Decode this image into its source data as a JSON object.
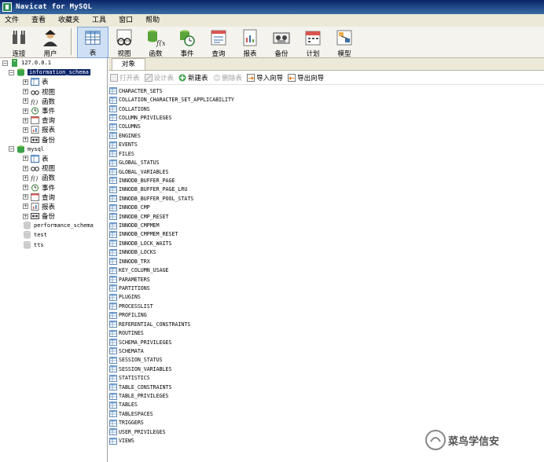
{
  "window": {
    "title": "Navicat for MySQL"
  },
  "menu": [
    "文件",
    "查看",
    "收藏夹",
    "工具",
    "窗口",
    "帮助"
  ],
  "toolbar": {
    "connect": "连接",
    "user": "用户",
    "table": "表",
    "view": "视图",
    "function": "函数",
    "event": "事件",
    "query": "查询",
    "report": "报表",
    "backup": "备份",
    "schedule": "计划",
    "model": "模型"
  },
  "tree": {
    "connection": "127.0.0.1",
    "db1": {
      "name": "information_schema",
      "children": [
        "表",
        "视图",
        "函数",
        "事件",
        "查询",
        "报表",
        "备份"
      ]
    },
    "db2": {
      "name": "mysql",
      "children": [
        "表",
        "视图",
        "函数",
        "事件",
        "查询",
        "报表",
        "备份"
      ]
    },
    "other_dbs": [
      "performance_schema",
      "test",
      "tts"
    ]
  },
  "main": {
    "tab": "对象",
    "actions": {
      "open": "打开表",
      "design": "设计表",
      "new": "新建表",
      "delete": "删除表",
      "import": "导入向导",
      "export": "导出向导"
    },
    "tables": [
      "CHARACTER_SETS",
      "COLLATION_CHARACTER_SET_APPLICABILITY",
      "COLLATIONS",
      "COLUMN_PRIVILEGES",
      "COLUMNS",
      "ENGINES",
      "EVENTS",
      "FILES",
      "GLOBAL_STATUS",
      "GLOBAL_VARIABLES",
      "INNODB_BUFFER_PAGE",
      "INNODB_BUFFER_PAGE_LRU",
      "INNODB_BUFFER_POOL_STATS",
      "INNODB_CMP",
      "INNODB_CMP_RESET",
      "INNODB_CMPMEM",
      "INNODB_CMPMEM_RESET",
      "INNODB_LOCK_WAITS",
      "INNODB_LOCKS",
      "INNODB_TRX",
      "KEY_COLUMN_USAGE",
      "PARAMETERS",
      "PARTITIONS",
      "PLUGINS",
      "PROCESSLIST",
      "PROFILING",
      "REFERENTIAL_CONSTRAINTS",
      "ROUTINES",
      "SCHEMA_PRIVILEGES",
      "SCHEMATA",
      "SESSION_STATUS",
      "SESSION_VARIABLES",
      "STATISTICS",
      "TABLE_CONSTRAINTS",
      "TABLE_PRIVILEGES",
      "TABLES",
      "TABLESPACES",
      "TRIGGERS",
      "USER_PRIVILEGES",
      "VIEWS"
    ]
  },
  "watermark": "菜鸟学信安",
  "colors": {
    "title_bar": "#0a246a",
    "selection": "#0a246a",
    "db_icon": "#3aa34a"
  }
}
